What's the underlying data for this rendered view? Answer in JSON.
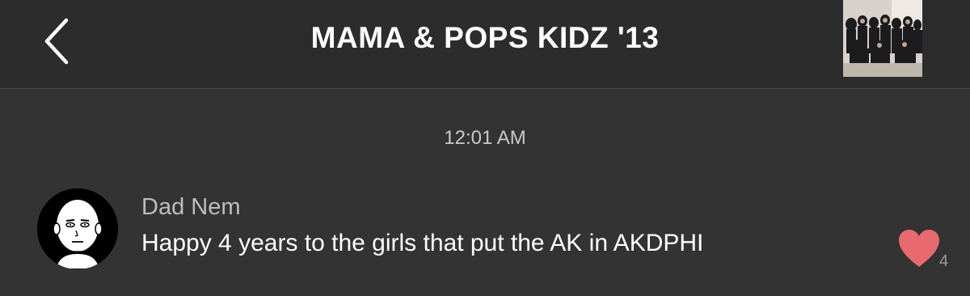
{
  "header": {
    "back_icon": "chevron-left-icon",
    "title": "MAMA & POPS KIDZ '13",
    "group_photo_icon": "group-photo-thumbnail"
  },
  "chat": {
    "timestamp": "12:01 AM",
    "messages": [
      {
        "sender": "Dad Nem",
        "text": "Happy 4 years to the girls that put the AK in AKDPHI",
        "avatar_icon": "cartoon-bald-head-avatar",
        "like_icon": "heart-icon",
        "like_count": "4",
        "like_color": "#e86a6f"
      }
    ]
  },
  "colors": {
    "background": "#333333",
    "header": "#2c2c2c",
    "text": "#ffffff",
    "muted_text": "#bdbdbd",
    "heart": "#e86a6f"
  }
}
